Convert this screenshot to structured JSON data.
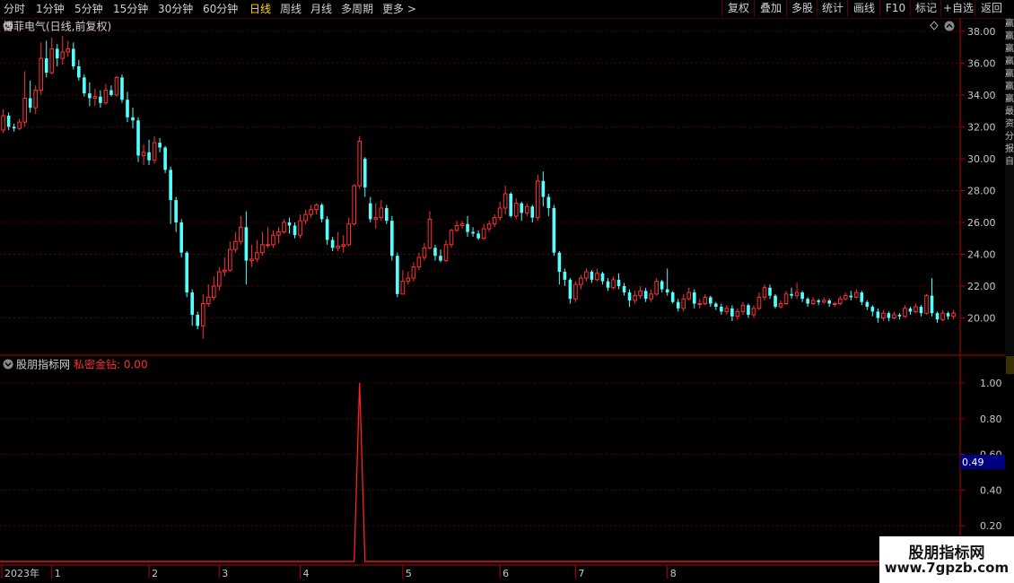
{
  "toolbar": {
    "periods": [
      "分时",
      "1分钟",
      "5分钟",
      "15分钟",
      "30分钟",
      "60分钟",
      "日线",
      "周线",
      "月线",
      "多周期",
      "更多"
    ],
    "active_period": "日线",
    "buttons": [
      "复权",
      "叠加",
      "多股",
      "统计",
      "画线",
      "F10",
      "标记",
      "+自选",
      "返回"
    ]
  },
  "main_chart": {
    "title": "博菲电气(日线,前复权)",
    "y_ticks": [
      "38.00",
      "36.00",
      "34.00",
      "32.00",
      "30.00",
      "28.00",
      "26.00",
      "24.00",
      "22.00",
      "20.00"
    ]
  },
  "indicator": {
    "name": "股朋指标网",
    "series_label": "私密金钻: 0.00",
    "y_ticks": [
      "1.00",
      "0.80",
      "0.60",
      "0.40",
      "0.20"
    ],
    "cursor_value": "0.49"
  },
  "date_axis": {
    "labels": [
      "2023年",
      "1",
      "2",
      "3",
      "4",
      "5",
      "6",
      "7",
      "8"
    ]
  },
  "right_strip": {
    "labels": [
      "赢",
      "赢",
      "赢",
      "赢",
      "赢",
      "赢",
      "赢",
      "最",
      "资",
      "分",
      "报",
      "自"
    ]
  },
  "watermark": {
    "line1": "股朋指标网",
    "line2": "www.7gpzb.com"
  },
  "colors": {
    "up": "#ff3232",
    "down": "#54ffff",
    "axis": "#b40000",
    "indicator_line": "#ff2020"
  },
  "chart_data": {
    "type": "candlestick",
    "ylim": [
      18,
      38.5
    ],
    "indicator_ylim": [
      0,
      1.05
    ],
    "indicator_values_note_free": true,
    "candles": [
      [
        31.8,
        32.7,
        31.6,
        33.1
      ],
      [
        32.7,
        32.0,
        31.8,
        32.9
      ],
      [
        32.0,
        31.9,
        31.7,
        32.2
      ],
      [
        31.9,
        32.3,
        31.8,
        32.5
      ],
      [
        32.3,
        33.8,
        32.0,
        35.5
      ],
      [
        33.8,
        33.2,
        32.9,
        34.9
      ],
      [
        33.2,
        34.3,
        32.8,
        34.6
      ],
      [
        34.3,
        36.3,
        34.0,
        37.3
      ],
      [
        36.3,
        35.4,
        35.1,
        37.4
      ],
      [
        35.4,
        36.9,
        35.3,
        37.6
      ],
      [
        36.9,
        36.3,
        35.8,
        37.2
      ],
      [
        36.3,
        36.7,
        35.9,
        37.7
      ],
      [
        36.7,
        36.9,
        36.4,
        37.4
      ],
      [
        36.9,
        35.8,
        35.6,
        37.3
      ],
      [
        35.8,
        35.1,
        34.9,
        36.2
      ],
      [
        35.1,
        34.1,
        33.9,
        35.3
      ],
      [
        34.1,
        33.8,
        33.3,
        34.8
      ],
      [
        33.8,
        33.9,
        33.3,
        34.4
      ],
      [
        33.9,
        33.5,
        33.2,
        34.3
      ],
      [
        33.5,
        34.3,
        33.4,
        34.7
      ],
      [
        34.3,
        34.0,
        33.9,
        34.6
      ],
      [
        34.0,
        35.1,
        33.9,
        35.2
      ],
      [
        35.1,
        33.7,
        33.5,
        35.3
      ],
      [
        33.7,
        32.6,
        32.3,
        34.2
      ],
      [
        32.6,
        32.4,
        31.9,
        33.2
      ],
      [
        32.4,
        30.2,
        29.8,
        32.6
      ],
      [
        30.2,
        30.4,
        29.6,
        30.9
      ],
      [
        30.4,
        29.9,
        29.6,
        31.2
      ],
      [
        29.9,
        31.0,
        29.7,
        31.4
      ],
      [
        31.0,
        30.7,
        30.4,
        31.3
      ],
      [
        30.7,
        29.3,
        29.1,
        30.8
      ],
      [
        29.3,
        27.4,
        25.9,
        29.5
      ],
      [
        27.4,
        26.0,
        25.4,
        27.6
      ],
      [
        26.0,
        24.1,
        23.8,
        26.2
      ],
      [
        24.1,
        21.6,
        21.3,
        24.2
      ],
      [
        21.6,
        20.2,
        19.5,
        21.8
      ],
      [
        20.2,
        19.5,
        19.3,
        20.4
      ],
      [
        19.5,
        20.9,
        18.7,
        21.5
      ],
      [
        20.9,
        21.3,
        20.7,
        22.1
      ],
      [
        21.3,
        22.0,
        21.1,
        22.6
      ],
      [
        22.0,
        22.9,
        21.7,
        23.2
      ],
      [
        22.9,
        23.0,
        22.6,
        23.8
      ],
      [
        23.0,
        24.3,
        22.9,
        24.8
      ],
      [
        24.3,
        24.8,
        24.1,
        25.4
      ],
      [
        24.8,
        25.7,
        24.6,
        26.4
      ],
      [
        25.7,
        23.6,
        22.1,
        26.7
      ],
      [
        23.6,
        23.7,
        23.2,
        24.6
      ],
      [
        23.7,
        24.1,
        23.5,
        24.9
      ],
      [
        24.1,
        24.6,
        23.9,
        25.4
      ],
      [
        24.6,
        24.6,
        24.4,
        25.7
      ],
      [
        24.6,
        25.2,
        24.4,
        25.5
      ],
      [
        25.2,
        25.4,
        24.7,
        25.7
      ],
      [
        25.4,
        26.0,
        25.3,
        26.2
      ],
      [
        26.0,
        25.8,
        25.3,
        26.3
      ],
      [
        25.8,
        25.2,
        25.0,
        26.0
      ],
      [
        25.2,
        26.1,
        25.0,
        26.5
      ],
      [
        26.1,
        26.5,
        25.9,
        26.8
      ],
      [
        26.5,
        26.8,
        26.3,
        27.1
      ],
      [
        26.8,
        27.1,
        26.5,
        27.2
      ],
      [
        27.1,
        26.2,
        26.0,
        27.2
      ],
      [
        26.2,
        24.9,
        24.6,
        26.4
      ],
      [
        24.9,
        24.4,
        24.2,
        25.1
      ],
      [
        24.4,
        24.5,
        24.2,
        25.4
      ],
      [
        24.5,
        24.6,
        24.1,
        25.2
      ],
      [
        24.6,
        25.9,
        24.5,
        26.3
      ],
      [
        25.9,
        28.3,
        25.8,
        28.4
      ],
      [
        28.3,
        31.1,
        28.1,
        31.4
      ],
      [
        30.0,
        28.2,
        27.6,
        30.1
      ],
      [
        27.2,
        26.2,
        26.0,
        27.6
      ],
      [
        26.2,
        26.3,
        25.6,
        27.2
      ],
      [
        26.3,
        26.9,
        26.1,
        27.4
      ],
      [
        26.9,
        26.1,
        25.9,
        27.1
      ],
      [
        26.1,
        23.9,
        23.6,
        26.4
      ],
      [
        23.9,
        21.5,
        21.3,
        24.1
      ],
      [
        21.5,
        22.3,
        21.5,
        23.0
      ],
      [
        22.3,
        22.5,
        22.1,
        22.9
      ],
      [
        22.5,
        23.2,
        22.3,
        23.5
      ],
      [
        23.2,
        23.8,
        23.0,
        24.1
      ],
      [
        23.8,
        24.4,
        23.6,
        24.7
      ],
      [
        24.4,
        26.2,
        24.3,
        26.7
      ],
      [
        24.4,
        23.9,
        23.6,
        24.6
      ],
      [
        23.9,
        23.6,
        23.5,
        24.3
      ],
      [
        23.6,
        24.6,
        23.5,
        24.9
      ],
      [
        24.6,
        25.5,
        24.4,
        25.6
      ],
      [
        25.5,
        25.8,
        25.4,
        26.1
      ],
      [
        25.8,
        25.9,
        25.6,
        26.1
      ],
      [
        25.9,
        25.4,
        25.1,
        26.4
      ],
      [
        25.4,
        25.3,
        25.1,
        25.7
      ],
      [
        25.3,
        25.0,
        24.9,
        25.5
      ],
      [
        25.0,
        25.6,
        24.9,
        25.9
      ],
      [
        25.6,
        25.9,
        25.4,
        26.1
      ],
      [
        25.9,
        26.3,
        25.7,
        26.5
      ],
      [
        26.3,
        26.9,
        26.1,
        27.3
      ],
      [
        26.9,
        27.8,
        26.5,
        28.3
      ],
      [
        27.8,
        26.4,
        26.3,
        27.9
      ],
      [
        26.4,
        27.2,
        26.2,
        27.5
      ],
      [
        27.2,
        26.6,
        26.1,
        27.3
      ],
      [
        26.6,
        27.0,
        26.4,
        27.2
      ],
      [
        27.0,
        26.3,
        26.0,
        27.1
      ],
      [
        26.3,
        28.6,
        26.1,
        29.0
      ],
      [
        28.6,
        27.6,
        27.0,
        29.2
      ],
      [
        27.6,
        26.9,
        26.4,
        27.8
      ],
      [
        26.9,
        24.1,
        23.9,
        27.1
      ],
      [
        24.1,
        22.9,
        22.1,
        24.2
      ],
      [
        22.9,
        22.4,
        22.0,
        23.1
      ],
      [
        22.4,
        21.2,
        20.9,
        22.5
      ],
      [
        21.2,
        22.1,
        21.0,
        22.3
      ],
      [
        22.1,
        22.5,
        21.8,
        22.7
      ],
      [
        22.5,
        22.9,
        22.3,
        23.1
      ],
      [
        22.9,
        22.4,
        22.2,
        23.0
      ],
      [
        22.4,
        22.8,
        22.3,
        23.1
      ],
      [
        22.8,
        22.3,
        22.1,
        22.9
      ],
      [
        22.3,
        21.9,
        21.7,
        22.5
      ],
      [
        21.9,
        22.4,
        21.8,
        22.6
      ],
      [
        22.4,
        22.0,
        21.8,
        22.8
      ],
      [
        22.0,
        21.6,
        21.4,
        22.2
      ],
      [
        21.6,
        21.1,
        20.7,
        21.8
      ],
      [
        21.1,
        21.4,
        20.9,
        21.7
      ],
      [
        21.4,
        21.7,
        21.2,
        22.0
      ],
      [
        21.7,
        21.2,
        21.0,
        21.9
      ],
      [
        21.2,
        21.5,
        21.0,
        21.8
      ],
      [
        21.5,
        22.3,
        21.4,
        22.5
      ],
      [
        22.3,
        21.8,
        21.6,
        22.4
      ],
      [
        21.8,
        21.6,
        21.4,
        23.1
      ],
      [
        21.6,
        21.0,
        20.9,
        21.7
      ],
      [
        21.0,
        20.6,
        20.4,
        21.2
      ],
      [
        20.6,
        21.2,
        20.4,
        21.5
      ],
      [
        21.2,
        21.6,
        21.1,
        21.9
      ],
      [
        21.6,
        20.9,
        20.6,
        21.8
      ],
      [
        20.9,
        20.9,
        20.6,
        21.2
      ],
      [
        20.9,
        21.3,
        20.8,
        21.5
      ],
      [
        21.3,
        20.9,
        20.7,
        21.4
      ],
      [
        20.9,
        20.7,
        20.5,
        21.0
      ],
      [
        20.7,
        20.4,
        20.2,
        20.9
      ],
      [
        20.4,
        20.6,
        20.2,
        20.8
      ],
      [
        20.6,
        20.1,
        19.8,
        20.8
      ],
      [
        20.1,
        20.4,
        19.9,
        20.6
      ],
      [
        20.4,
        20.8,
        20.2,
        21.0
      ],
      [
        20.8,
        20.2,
        20.0,
        20.9
      ],
      [
        20.2,
        20.6,
        20.0,
        20.8
      ],
      [
        20.6,
        21.3,
        20.5,
        21.6
      ],
      [
        21.3,
        21.9,
        21.1,
        22.1
      ],
      [
        21.9,
        21.4,
        21.2,
        22.1
      ],
      [
        21.4,
        20.7,
        20.6,
        21.5
      ],
      [
        20.7,
        20.9,
        20.6,
        21.1
      ],
      [
        20.9,
        21.5,
        20.8,
        21.7
      ],
      [
        21.5,
        21.4,
        21.2,
        21.9
      ],
      [
        21.4,
        21.6,
        21.2,
        22.2
      ],
      [
        21.6,
        21.2,
        21.0,
        21.7
      ],
      [
        21.2,
        20.9,
        20.7,
        21.3
      ],
      [
        20.9,
        21.1,
        20.8,
        21.3
      ],
      [
        21.1,
        21.0,
        20.8,
        21.2
      ],
      [
        21.0,
        21.1,
        20.9,
        21.3
      ],
      [
        21.1,
        20.9,
        20.7,
        21.2
      ],
      [
        20.9,
        20.9,
        20.7,
        21.0
      ],
      [
        20.9,
        21.2,
        20.8,
        21.4
      ],
      [
        21.2,
        21.4,
        21.1,
        21.6
      ],
      [
        21.4,
        21.3,
        21.1,
        21.7
      ],
      [
        21.3,
        21.6,
        21.2,
        21.8
      ],
      [
        21.6,
        21.0,
        20.8,
        21.7
      ],
      [
        21.0,
        20.7,
        20.5,
        21.1
      ],
      [
        20.7,
        20.4,
        20.1,
        20.8
      ],
      [
        20.4,
        20.0,
        19.7,
        20.6
      ],
      [
        20.0,
        20.3,
        19.8,
        20.5
      ],
      [
        20.3,
        20.0,
        19.8,
        20.4
      ],
      [
        20.0,
        20.2,
        19.9,
        20.4
      ],
      [
        20.2,
        20.1,
        19.9,
        20.3
      ],
      [
        20.1,
        20.6,
        20.0,
        20.8
      ],
      [
        20.6,
        20.4,
        20.2,
        20.7
      ],
      [
        20.4,
        20.7,
        20.3,
        20.9
      ],
      [
        20.7,
        20.3,
        20.1,
        20.8
      ],
      [
        20.3,
        21.4,
        20.2,
        21.5
      ],
      [
        21.4,
        20.3,
        20.1,
        22.5
      ],
      [
        20.3,
        19.9,
        19.7,
        20.4
      ],
      [
        19.9,
        20.3,
        19.8,
        20.5
      ],
      [
        20.3,
        20.1,
        19.9,
        20.4
      ],
      [
        20.1,
        20.3,
        19.9,
        20.5
      ]
    ],
    "indicator_spike": {
      "index": 66,
      "value": 1.0
    },
    "indicator_baseline": 0
  }
}
